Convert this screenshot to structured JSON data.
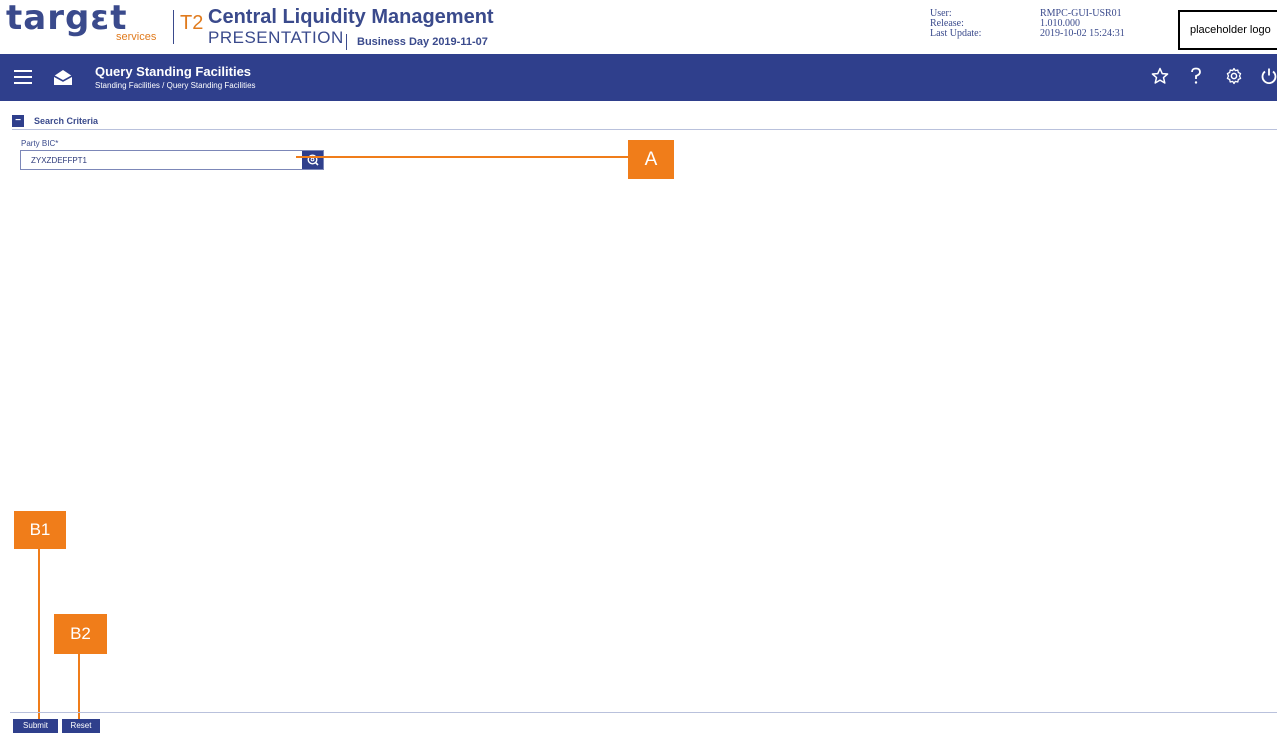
{
  "header": {
    "logo_word": "targεt",
    "logo_sub": "services",
    "t2_label": "T2",
    "app_title": "Central Liquidity Management",
    "environment": "PRESENTATION",
    "business_day": "Business Day 2019-11-07",
    "meta": [
      {
        "label": "User:",
        "value": "RMPC-GUI-USR01"
      },
      {
        "label": "Release:",
        "value": "1.010.000"
      },
      {
        "label": "Last Update:",
        "value": "2019-10-02 15:24:31"
      }
    ],
    "placeholder_logo": "placeholder logo"
  },
  "navbar": {
    "title": "Query Standing Facilities",
    "breadcrumb": "Standing Facilities  /  Query Standing Facilities",
    "icons": [
      "star-icon",
      "help-icon",
      "gear-icon",
      "power-icon"
    ]
  },
  "search": {
    "toggle": "−",
    "title": "Search Criteria",
    "party_bic_label": "Party BIC*",
    "party_bic_value": "ZYXZDEFFPT1"
  },
  "annotations": {
    "a": "A",
    "b1": "B1",
    "b2": "B2"
  },
  "buttons": {
    "submit": "Submit",
    "reset": "Reset"
  },
  "colors": {
    "brand_blue": "#2f3f8c",
    "accent_orange": "#f07d1a"
  }
}
